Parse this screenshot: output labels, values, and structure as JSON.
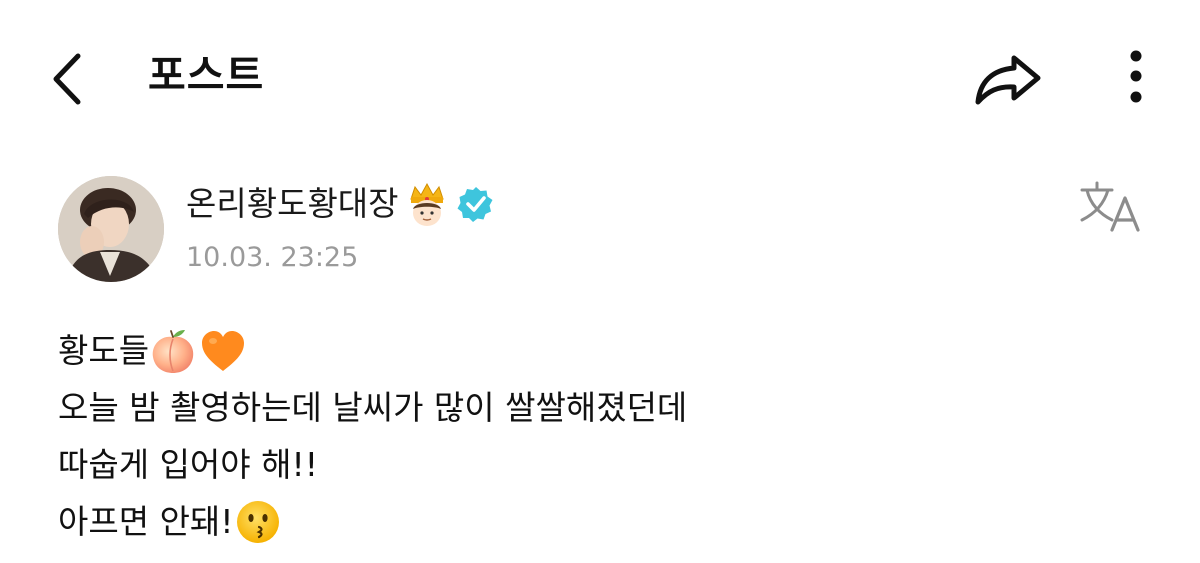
{
  "header": {
    "title": "포스트",
    "back_icon": "chevron-left-icon",
    "share_icon": "share-arrow-icon",
    "more_icon": "vertical-dots-icon"
  },
  "post": {
    "author": {
      "name": "온리황도황대장",
      "badge_icon": "crown-king-emoji",
      "verified_icon": "verified-check-icon",
      "verified_color": "#3ec5dd"
    },
    "timestamp": "10.03. 23:25",
    "translate_icon": "translate-icon",
    "lines": [
      {
        "text": "황도들",
        "emojis": [
          "peach-emoji",
          "orange-heart-emoji"
        ]
      },
      {
        "text": "오늘 밤 촬영하는데 날씨가 많이 쌀쌀해졌던데",
        "emojis": []
      },
      {
        "text": "따숩게 입어야 해!!",
        "emojis": []
      },
      {
        "text": "아프면 안돼!",
        "emojis": [
          "kissing-face-emoji"
        ]
      }
    ]
  },
  "colors": {
    "text": "#111111",
    "muted": "#9a9a9a",
    "verified": "#3ec5dd",
    "heart": "#ff8a1e"
  }
}
